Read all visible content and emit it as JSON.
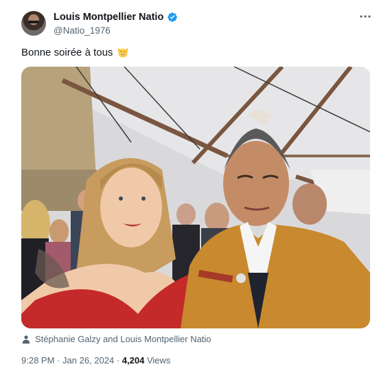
{
  "author": {
    "display_name": "Louis Montpellier Natio",
    "handle": "@Natio_1976",
    "verified": true
  },
  "tweet": {
    "text": "Bonne soirée à tous",
    "emoji": "grinning-cat-face",
    "image_description_icon": "photo",
    "tagged_people": "Stéphanie Galzy and Louis Montpellier Natio"
  },
  "meta": {
    "time": "9:28 PM",
    "separator": "·",
    "date": "Jan 26, 2024",
    "views_count": "4,204",
    "views_label": "Views"
  },
  "colors": {
    "verified_blue": "#1d9bf0",
    "secondary_text": "#536471",
    "primary_text": "#0f1419"
  },
  "icons": [
    "verified-badge-icon",
    "more-options-icon",
    "person-icon",
    "grinning-cat-emoji"
  ]
}
